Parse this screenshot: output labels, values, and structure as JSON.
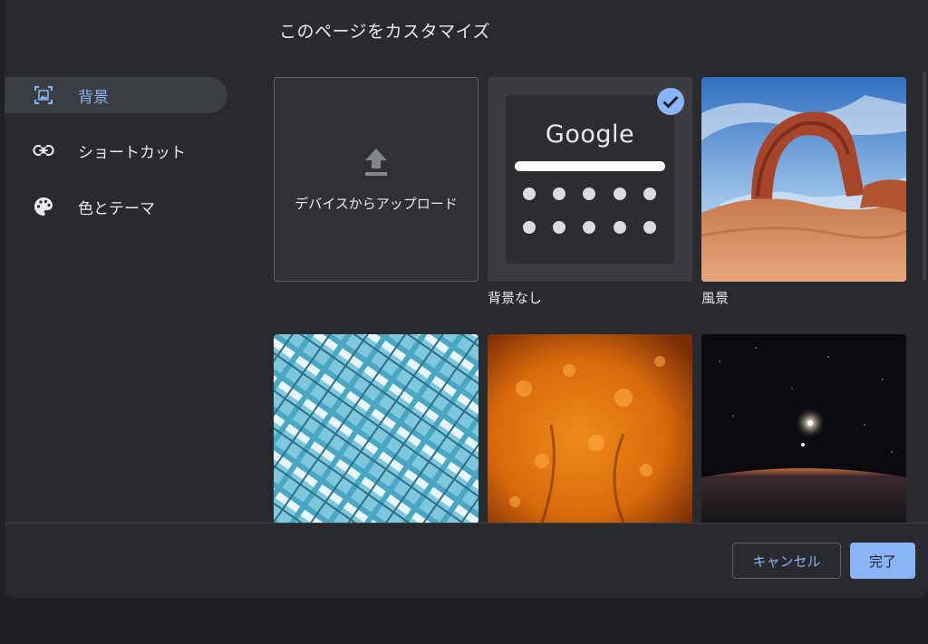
{
  "dialog": {
    "title": "このページをカスタマイズ"
  },
  "sidebar": {
    "items": [
      {
        "label": "背景",
        "icon": "background-image-icon",
        "active": true
      },
      {
        "label": "ショートカット",
        "icon": "link-icon",
        "active": false
      },
      {
        "label": "色とテーマ",
        "icon": "palette-icon",
        "active": false
      }
    ]
  },
  "tiles": {
    "upload_label": "デバイスからアップロード",
    "no_background_label": "背景なし",
    "no_background_logo": "Google",
    "landscape_label": "風景"
  },
  "footer": {
    "cancel_label": "キャンセル",
    "done_label": "完了"
  },
  "colors": {
    "accent": "#8ab4f8",
    "background": "#292a2d",
    "surface": "#303134"
  }
}
